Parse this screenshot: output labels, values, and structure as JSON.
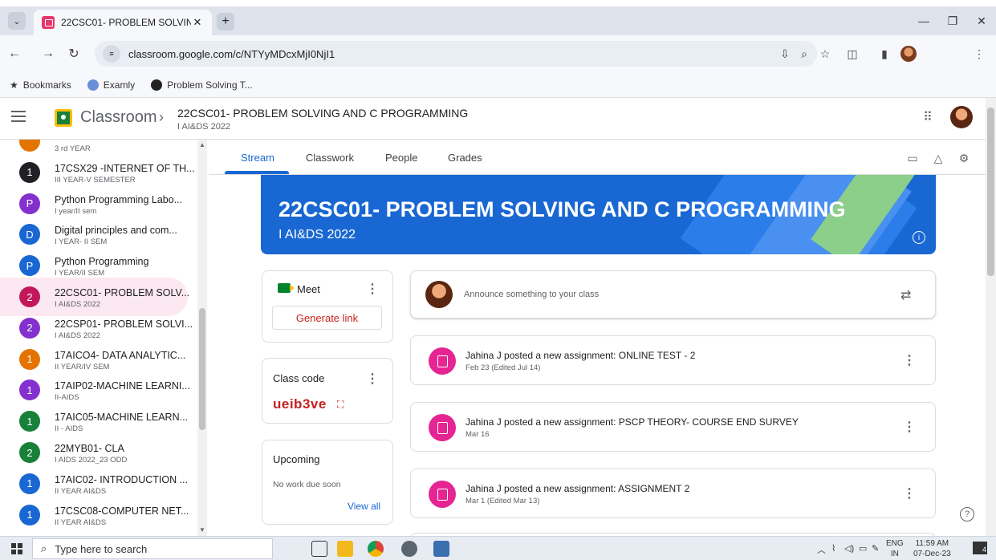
{
  "browser": {
    "tab_title": "22CSC01- PROBLEM SOLVING",
    "tab_close": "✕",
    "new_tab": "+",
    "url": "classroom.google.com/c/NTYyMDcxMjI0NjI1",
    "bookmarks": [
      {
        "label": "Bookmarks"
      },
      {
        "label": "Examly"
      },
      {
        "label": "Problem Solving T..."
      }
    ]
  },
  "header": {
    "app_name": "Classroom",
    "separator": "›",
    "class_title": "22CSC01- PROBLEM SOLVING AND C PROGRAMMING",
    "class_subtitle": "I AI&DS 2022"
  },
  "sidebar": {
    "items": [
      {
        "badge": "",
        "title": "",
        "subtitle": "3 rd YEAR",
        "color": "#e37400"
      },
      {
        "badge": "1",
        "title": "17CSX29 -INTERNET OF TH...",
        "subtitle": "III YEAR-V SEMESTER",
        "color": "#202124"
      },
      {
        "badge": "P",
        "title": "Python Programming Labo...",
        "subtitle": "I year/II sem",
        "color": "#8430ce"
      },
      {
        "badge": "D",
        "title": "Digital principles and com...",
        "subtitle": "I YEAR- II SEM",
        "color": "#1967d2"
      },
      {
        "badge": "P",
        "title": "Python Programming",
        "subtitle": "I YEAR/II SEM",
        "color": "#1967d2"
      },
      {
        "badge": "2",
        "title": "22CSC01- PROBLEM SOLV...",
        "subtitle": "I AI&DS 2022",
        "color": "#c2185b",
        "active": true
      },
      {
        "badge": "2",
        "title": "22CSP01- PROBLEM SOLVI...",
        "subtitle": "I AI&DS 2022",
        "color": "#8430ce"
      },
      {
        "badge": "1",
        "title": "17AICO4- DATA ANALYTIC...",
        "subtitle": "II YEAR/IV SEM",
        "color": "#e37400"
      },
      {
        "badge": "1",
        "title": "17AIP02-MACHINE LEARNI...",
        "subtitle": "II-AIDS",
        "color": "#8430ce"
      },
      {
        "badge": "1",
        "title": "17AIC05-MACHINE LEARN...",
        "subtitle": "II - AIDS",
        "color": "#188038"
      },
      {
        "badge": "2",
        "title": "22MYB01- CLA",
        "subtitle": "I AIDS 2022_23 ODD",
        "color": "#188038"
      },
      {
        "badge": "1",
        "title": "17AIC02- INTRODUCTION ...",
        "subtitle": "II YEAR AI&DS",
        "color": "#1967d2"
      },
      {
        "badge": "1",
        "title": "17CSC08-COMPUTER NET...",
        "subtitle": "II YEAR AI&DS",
        "color": "#1967d2"
      }
    ]
  },
  "tabs": [
    {
      "label": "Stream",
      "active": true
    },
    {
      "label": "Classwork"
    },
    {
      "label": "People"
    },
    {
      "label": "Grades"
    }
  ],
  "banner": {
    "title": "22CSC01- PROBLEM SOLVING AND C PROGRAMMING",
    "subtitle": "I AI&DS 2022",
    "info": "i"
  },
  "meet": {
    "title": "Meet",
    "button": "Generate link"
  },
  "class_code": {
    "label": "Class code",
    "value": "ueib3ve"
  },
  "upcoming": {
    "label": "Upcoming",
    "empty": "No work due soon",
    "view_all": "View all"
  },
  "announce": {
    "placeholder": "Announce something to your class"
  },
  "posts": [
    {
      "title": "Jahina J posted a new assignment: ONLINE TEST - 2",
      "date": "Feb 23 (Edited Jul 14)"
    },
    {
      "title": "Jahina J posted a new assignment: PSCP THEORY- COURSE END SURVEY",
      "date": "Mar 16"
    },
    {
      "title": "Jahina J posted a new assignment: ASSIGNMENT 2",
      "date": "Mar 1 (Edited Mar 13)"
    }
  ],
  "taskbar": {
    "search_placeholder": "Type here to search",
    "lang_top": "ENG",
    "lang_bottom": "IN",
    "time": "11:59 AM",
    "date": "07-Dec-23",
    "notifications": "4"
  },
  "colors": {
    "accent": "#1967d2",
    "brand_red": "#c5221f",
    "assignment_icon": "#e52592"
  }
}
